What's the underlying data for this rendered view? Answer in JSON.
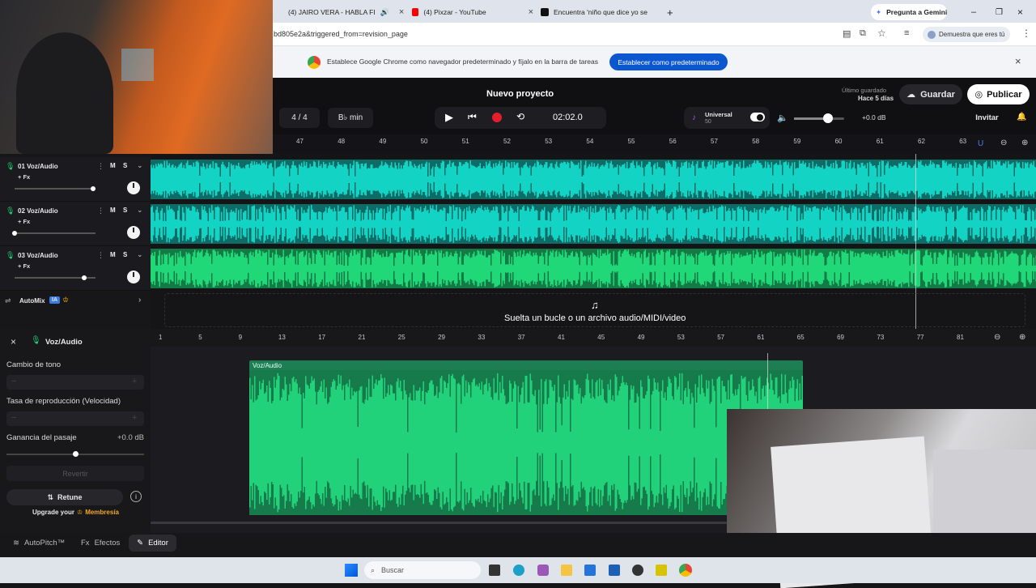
{
  "browser": {
    "tabs": [
      {
        "title": "(4) JAIRO VERA - HABLA FI",
        "icon": "youtube-icon"
      },
      {
        "title": "(4) Pixzar - YouTube",
        "icon": "youtube-icon"
      },
      {
        "title": "Encuentra 'niño que dice yo se",
        "icon": "tiktok-icon"
      }
    ],
    "new_tab": "+",
    "gemini": "Pregunta a Gemini",
    "url": "bd805e2a&triggered_from=revision_page",
    "profile": "Demuestra que eres tú",
    "infobar_text": "Establece Google Chrome como navegador predeterminado y fíjalo en la barra de tareas",
    "infobar_button": "Establecer como predeterminado"
  },
  "app": {
    "project_title": "Nuevo proyecto",
    "last_saved_label": "Último guardado",
    "last_saved_value": "Hace 5 días",
    "save": "Guardar",
    "publish": "Publicar",
    "time_signature": "4 / 4",
    "key": "B♭ min",
    "time": "02:02.0",
    "preset_name": "Universal",
    "preset_value": "50",
    "volume_db": "+0.0 dB",
    "invite": "Invitar"
  },
  "ruler_top": [
    "47",
    "48",
    "49",
    "50",
    "51",
    "52",
    "53",
    "54",
    "55",
    "56",
    "57",
    "58",
    "59",
    "60",
    "61",
    "62",
    "63"
  ],
  "tracks": [
    {
      "name": "01 Voz/Audio",
      "fx": "+ Fx",
      "mute": "M",
      "solo": "S",
      "color": "#13d4c4",
      "volume": 0.97
    },
    {
      "name": "02 Voz/Audio",
      "fx": "+ Fx",
      "mute": "M",
      "solo": "S",
      "color": "#13d4c4",
      "volume": 0.0
    },
    {
      "name": "03 Voz/Audio",
      "fx": "+ Fx",
      "mute": "M",
      "solo": "S",
      "color": "#20d878",
      "volume": 0.86
    }
  ],
  "automix": {
    "label": "AutoMix",
    "badge": "IA"
  },
  "drop_hint": "Suelta un bucle o un archivo audio/MIDI/video",
  "editor": {
    "title": "Voz/Audio",
    "pitch_label": "Cambio de tono",
    "speed_label": "Tasa de reproducción (Velocidad)",
    "gain_label": "Ganancia del pasaje",
    "gain_value": "+0.0 dB",
    "revert": "Revertir",
    "retune": "Retune",
    "upgrade_prefix": "Upgrade your",
    "membership": "Membresía",
    "clip_label": "Voz/Audio"
  },
  "ruler_bottom": [
    "1",
    "5",
    "9",
    "13",
    "17",
    "21",
    "25",
    "29",
    "33",
    "37",
    "41",
    "45",
    "49",
    "53",
    "57",
    "61",
    "65",
    "69",
    "73",
    "77",
    "81"
  ],
  "bottom_tabs": {
    "autopitch": "AutoPitch™",
    "effects": "Efectos",
    "editor": "Editor"
  },
  "taskbar": {
    "search": "Buscar"
  }
}
